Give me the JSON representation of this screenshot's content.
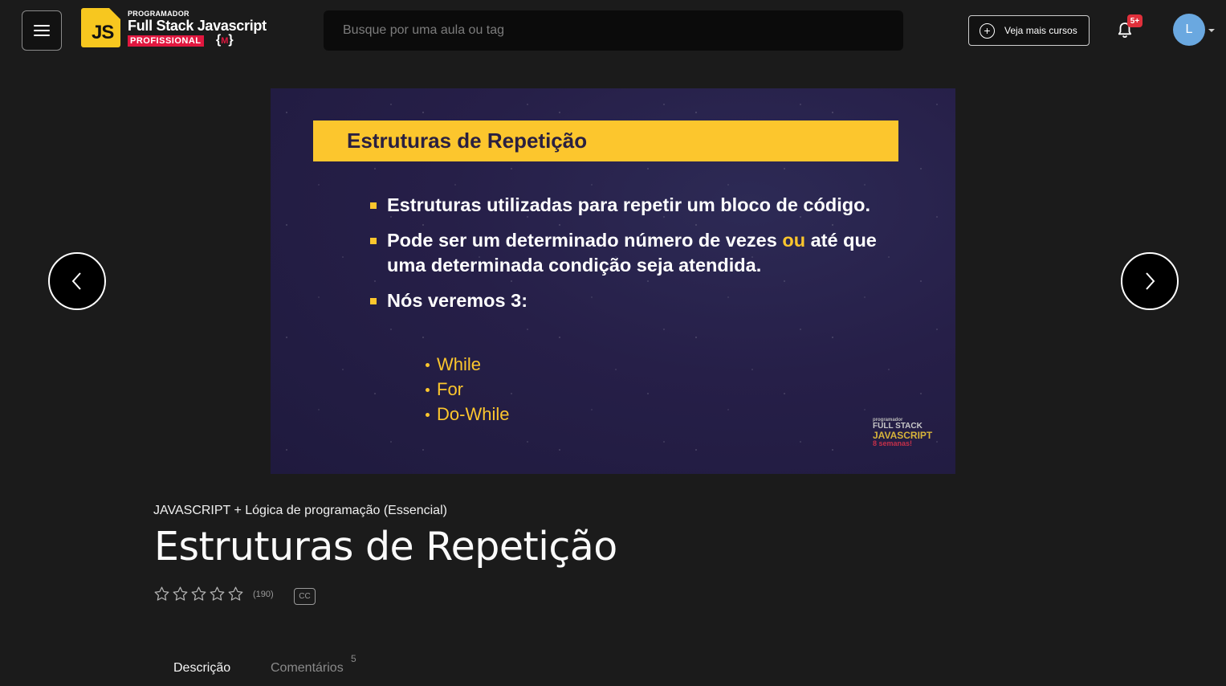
{
  "header": {
    "logo": {
      "js": "JS",
      "small": "PROGRAMADOR",
      "big": "Full Stack Javascript",
      "pro": "PROFISSIONAL"
    },
    "search_placeholder": "Busque por uma aula ou tag",
    "more_courses_label": "Veja mais cursos",
    "notification_badge": "5+",
    "avatar_initial": "L"
  },
  "slide": {
    "heading": "Estruturas de Repetição",
    "bullets": [
      {
        "text": "Estruturas utilizadas para repetir um bloco de código."
      },
      {
        "before": "Pode ser um determinado número de vezes ",
        "highlight": "ou",
        "after": " até que uma determinada condição seja  atendida."
      },
      {
        "text": "Nós veremos 3:"
      }
    ],
    "sub_items": [
      "While",
      "For",
      "Do-While"
    ],
    "watermark": [
      "programador",
      "FULL STACK",
      "JAVASCRIPT",
      "8 semanas!"
    ]
  },
  "lesson": {
    "course_name": "JAVASCRIPT + Lógica de programação (Essencial)",
    "title": "Estruturas de Repetição",
    "rating_count": "(190)",
    "rating_stars_filled": 0,
    "rating_stars_total": 5,
    "cc_label": "CC"
  },
  "tabs": {
    "description": "Descrição",
    "comments": "Comentários",
    "comments_count": "5"
  }
}
